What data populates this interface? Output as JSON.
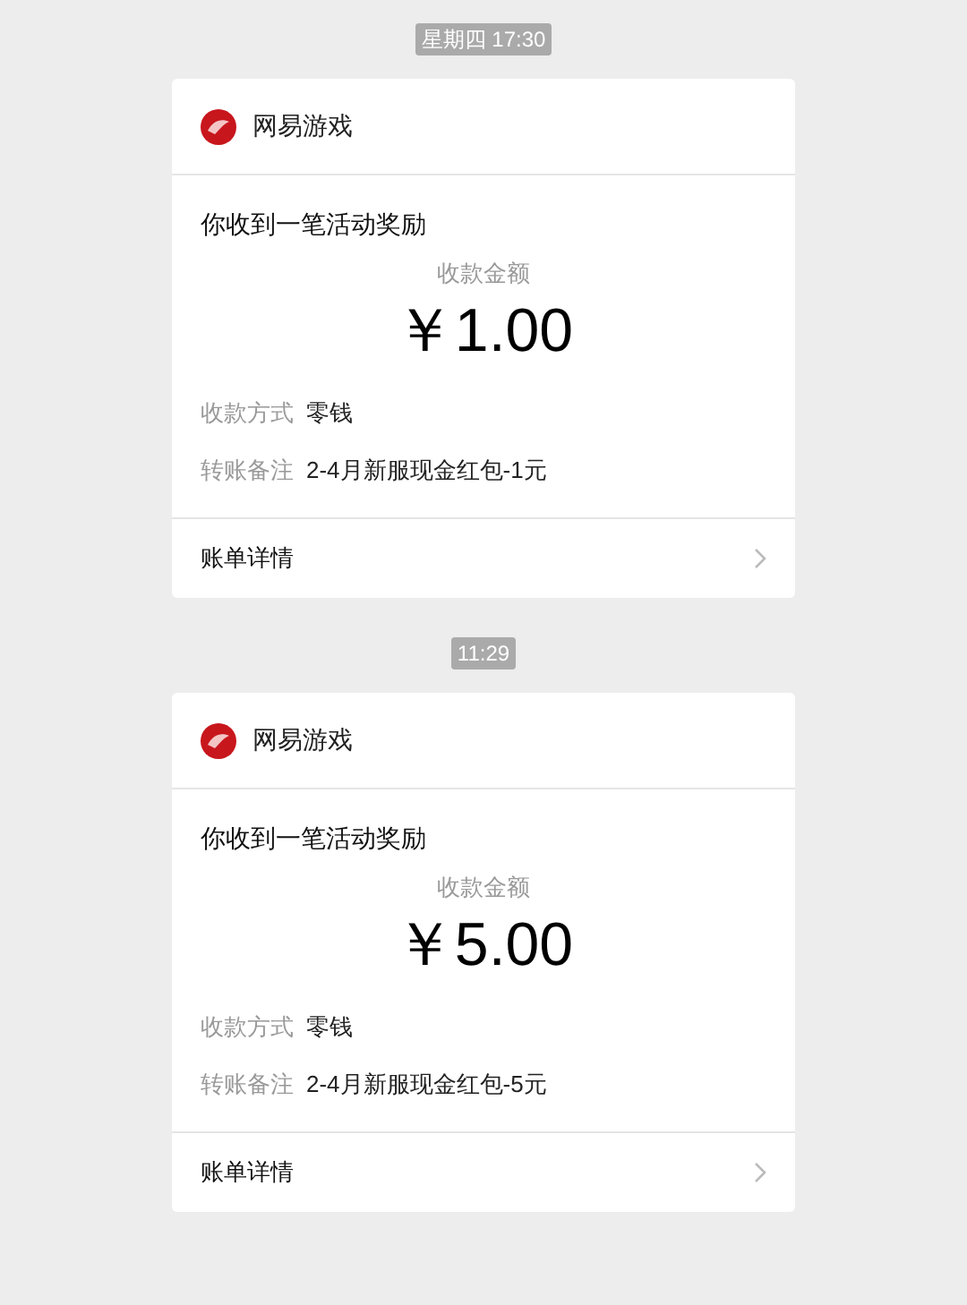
{
  "messages": [
    {
      "time": "星期四 17:30",
      "sender": "网易游戏",
      "title": "你收到一笔活动奖励",
      "amount_label": "收款金额",
      "amount": "￥1.00",
      "fields": [
        {
          "label": "收款方式",
          "value": "零钱"
        },
        {
          "label": "转账备注",
          "value": "2-4月新服现金红包-1元"
        }
      ],
      "footer": "账单详情"
    },
    {
      "time": "11:29",
      "sender": "网易游戏",
      "title": "你收到一笔活动奖励",
      "amount_label": "收款金额",
      "amount": "￥5.00",
      "fields": [
        {
          "label": "收款方式",
          "value": "零钱"
        },
        {
          "label": "转账备注",
          "value": "2-4月新服现金红包-5元"
        }
      ],
      "footer": "账单详情"
    }
  ]
}
